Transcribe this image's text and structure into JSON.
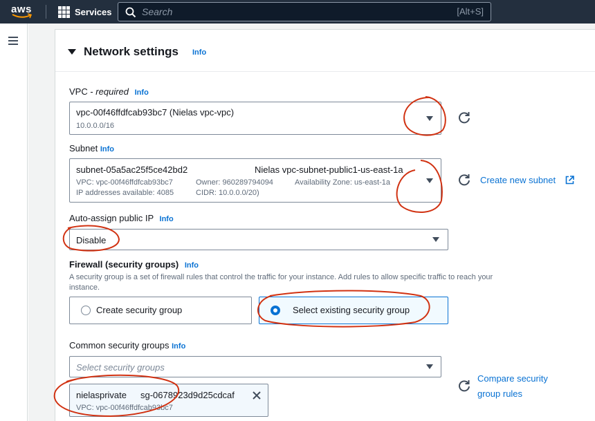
{
  "topnav": {
    "logo_text": "aws",
    "services_label": "Services",
    "search_placeholder": "Search",
    "search_shortcut": "[Alt+S]"
  },
  "section": {
    "title": "Network settings",
    "info_label": "Info"
  },
  "vpc": {
    "label": "VPC",
    "required_text": "required",
    "label_separator": " - ",
    "info_label": "Info",
    "selected_name": "vpc-00f46ffdfcab93bc7 (Nielas vpc-vpc)",
    "cidr": "10.0.0.0/16"
  },
  "subnet": {
    "label": "Subnet",
    "info_label": "Info",
    "selected_id": "subnet-05a5ac25f5ce42bd2",
    "selected_name": "Nielas vpc-subnet-public1-us-east-1a",
    "vpc_detail": "VPC: vpc-00f46ffdfcab93bc7",
    "owner_detail": "Owner: 960289794094",
    "az_detail": "Availability Zone: us-east-1a",
    "ip_detail": "IP addresses available: 4085",
    "cidr_detail": "CIDR: 10.0.0.0/20)",
    "create_link": "Create new subnet"
  },
  "auto_assign": {
    "label": "Auto-assign public IP",
    "info_label": "Info",
    "selected_value": "Disable"
  },
  "firewall": {
    "label": "Firewall (security groups)",
    "info_label": "Info",
    "description_line1": "A security group is a set of firewall rules that control the traffic for your instance. Add rules to allow specific traffic to reach your",
    "description_line2": "instance.",
    "option_create": "Create security group",
    "option_select": "Select existing security group",
    "selected_option": "Select existing security group"
  },
  "common_sg": {
    "label": "Common security groups",
    "info_label": "Info",
    "placeholder": "Select security groups",
    "token_name": "nielasprivate",
    "token_id": "sg-0678923d9d25cdcaf",
    "token_vpc": "VPC: vpc-00f46ffdfcab93bc7",
    "compare_link_line1": "Compare security",
    "compare_link_line2": "group rules"
  },
  "colors": {
    "nav_bg": "#232f3e",
    "link": "#0972d3",
    "selected_border": "#0972d3",
    "annotation": "#d13212"
  },
  "icons": [
    "aws-logo",
    "services-grid-icon",
    "search-icon",
    "hamburger-menu-icon",
    "caret-down-icon",
    "refresh-icon",
    "external-link-icon",
    "close-icon"
  ]
}
